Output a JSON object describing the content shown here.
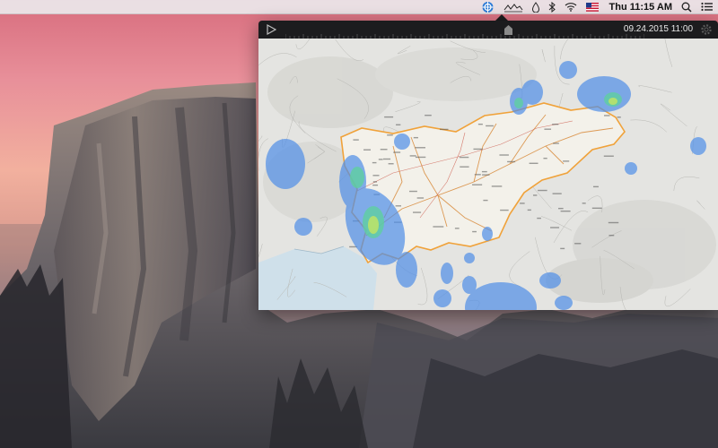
{
  "menubar": {
    "flag_icon": "us-flag-icon",
    "clock": "Thu 11:15 AM",
    "icons": [
      "radar-app-icon",
      "activity-graph-icon",
      "drop-icon",
      "bluetooth-icon",
      "wifi-icon",
      "search-icon",
      "list-icon"
    ]
  },
  "panel": {
    "timestamp": "09.24.2015 11:00",
    "timeline_position": 0.62
  },
  "colors": {
    "panel_bg": "#1c1c1e",
    "rain_light": "#4f8ee8",
    "rain_medium": "#5fd0a0",
    "rain_heavy": "#b9e26a",
    "border_route": "#f0a23a"
  }
}
